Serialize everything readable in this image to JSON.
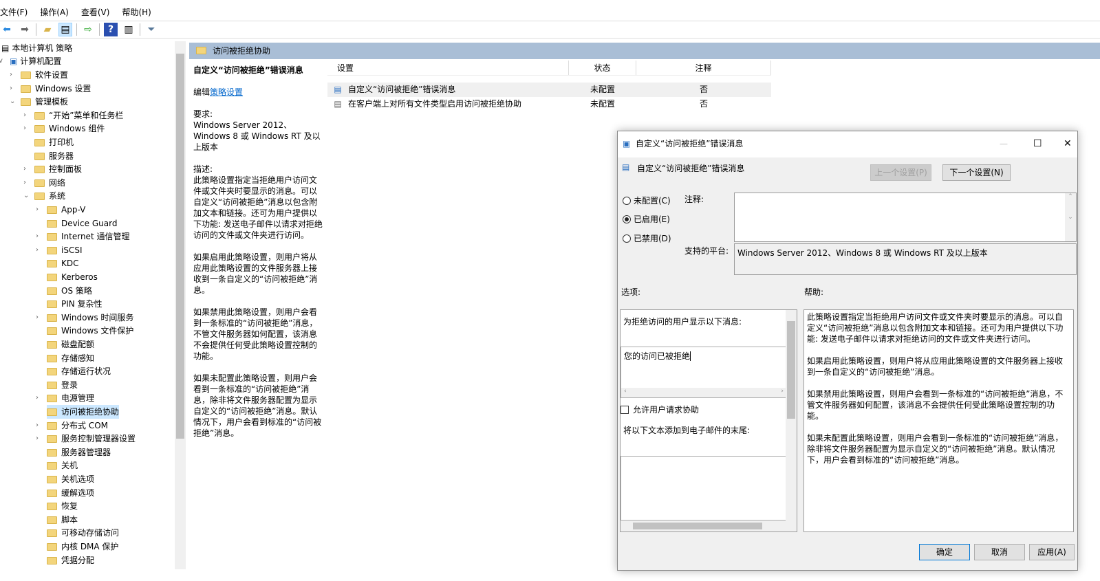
{
  "menu": [
    "文件(F)",
    "操作(A)",
    "查看(V)",
    "帮助(H)"
  ],
  "toolbar": [
    "back-icon",
    "forward-icon",
    "up-folder-icon",
    "show-hide-tree-icon",
    "export-icon",
    "help-icon",
    "show-action-pane-icon",
    "filter-icon"
  ],
  "tree": {
    "root": "本地计算机 策略",
    "computer": "计算机配置",
    "items": [
      {
        "label": "软件设置",
        "lvl": 1,
        "chev": ">"
      },
      {
        "label": "Windows 设置",
        "lvl": 1,
        "chev": ">"
      },
      {
        "label": "管理模板",
        "lvl": 1,
        "chev": "v"
      },
      {
        "label": "“开始”菜单和任务栏",
        "lvl": 2,
        "chev": ">"
      },
      {
        "label": "Windows 组件",
        "lvl": 2,
        "chev": ">"
      },
      {
        "label": "打印机",
        "lvl": 2,
        "chev": ""
      },
      {
        "label": "服务器",
        "lvl": 2,
        "chev": ""
      },
      {
        "label": "控制面板",
        "lvl": 2,
        "chev": ">"
      },
      {
        "label": "网络",
        "lvl": 2,
        "chev": ">"
      },
      {
        "label": "系统",
        "lvl": 2,
        "chev": "v"
      },
      {
        "label": "App-V",
        "lvl": 3,
        "chev": ">"
      },
      {
        "label": "Device Guard",
        "lvl": 3,
        "chev": ""
      },
      {
        "label": "Internet 通信管理",
        "lvl": 3,
        "chev": ">"
      },
      {
        "label": "iSCSI",
        "lvl": 3,
        "chev": ">"
      },
      {
        "label": "KDC",
        "lvl": 3,
        "chev": ""
      },
      {
        "label": "Kerberos",
        "lvl": 3,
        "chev": ""
      },
      {
        "label": "OS 策略",
        "lvl": 3,
        "chev": ""
      },
      {
        "label": "PIN 复杂性",
        "lvl": 3,
        "chev": ""
      },
      {
        "label": "Windows 时间服务",
        "lvl": 3,
        "chev": ">"
      },
      {
        "label": "Windows 文件保护",
        "lvl": 3,
        "chev": ""
      },
      {
        "label": "磁盘配额",
        "lvl": 3,
        "chev": ""
      },
      {
        "label": "存储感知",
        "lvl": 3,
        "chev": ""
      },
      {
        "label": "存储运行状况",
        "lvl": 3,
        "chev": ""
      },
      {
        "label": "登录",
        "lvl": 3,
        "chev": ""
      },
      {
        "label": "电源管理",
        "lvl": 3,
        "chev": ">"
      },
      {
        "label": "访问被拒绝协助",
        "lvl": 3,
        "chev": "",
        "sel": true
      },
      {
        "label": "分布式 COM",
        "lvl": 3,
        "chev": ">"
      },
      {
        "label": "服务控制管理器设置",
        "lvl": 3,
        "chev": ">"
      },
      {
        "label": "服务器管理器",
        "lvl": 3,
        "chev": ""
      },
      {
        "label": "关机",
        "lvl": 3,
        "chev": ""
      },
      {
        "label": "关机选项",
        "lvl": 3,
        "chev": ""
      },
      {
        "label": "缓解选项",
        "lvl": 3,
        "chev": ""
      },
      {
        "label": "恢复",
        "lvl": 3,
        "chev": ""
      },
      {
        "label": "脚本",
        "lvl": 3,
        "chev": ""
      },
      {
        "label": "可移动存储访问",
        "lvl": 3,
        "chev": ""
      },
      {
        "label": "内核 DMA 保护",
        "lvl": 3,
        "chev": ""
      },
      {
        "label": "凭据分配",
        "lvl": 3,
        "chev": ""
      }
    ]
  },
  "header": "访问被拒绝协助",
  "desc": {
    "title": "自定义“访问被拒绝”错误消息",
    "edit": "编辑",
    "edit_link": "策略设置",
    "req_label": "要求:",
    "req": "Windows Server 2012、Windows 8 或 Windows RT 及以上版本",
    "desc_label": "描述:",
    "p1": "此策略设置指定当拒绝用户访问文件或文件夹时要显示的消息。可以自定义“访问被拒绝”消息以包含附加文本和链接。还可为用户提供以下功能: 发送电子邮件以请求对拒绝访问的文件或文件夹进行访问。",
    "p2": "如果启用此策略设置，则用户将从应用此策略设置的文件服务器上接收到一条自定义的“访问被拒绝”消息。",
    "p3": "如果禁用此策略设置，则用户会看到一条标准的“访问被拒绝”消息，不管文件服务器如何配置，该消息不会提供任何受此策略设置控制的功能。",
    "p4": "如果未配置此策略设置，则用户会看到一条标准的“访问被拒绝”消息，除非将文件服务器配置为显示自定义的“访问被拒绝”消息。默认情况下，用户会看到标准的“访问被拒绝”消息。"
  },
  "list": {
    "cols": [
      "设置",
      "状态",
      "注释"
    ],
    "rows": [
      [
        "自定义“访问被拒绝”错误消息",
        "未配置",
        "否"
      ],
      [
        "在客户端上对所有文件类型启用访问被拒绝协助",
        "未配置",
        "否"
      ]
    ]
  },
  "dialog": {
    "title": "自定义“访问被拒绝”错误消息",
    "policy": "自定义“访问被拒绝”错误消息",
    "prev": "上一个设置(P)",
    "next": "下一个设置(N)",
    "radios": [
      "未配置(C)",
      "已启用(E)",
      "已禁用(D)"
    ],
    "selected": 1,
    "comment_label": "注释:",
    "platform_label": "支持的平台:",
    "platform": "Windows Server 2012、Windows 8 或 Windows RT 及以上版本",
    "options_label": "选项:",
    "help_label": "帮助:",
    "opt_msg_label": "为拒绝访问的用户显示以下消息:",
    "opt_msg_value": "您的访问已被拒绝",
    "opt_checkbox": "允许用户请求协助",
    "opt_checked": false,
    "opt_email_label": "将以下文本添加到电子邮件的末尾:",
    "help": "此策略设置指定当拒绝用户访问文件或文件夹时要显示的消息。可以自定义“访问被拒绝”消息以包含附加文本和链接。还可为用户提供以下功能: 发送电子邮件以请求对拒绝访问的文件或文件夹进行访问。\n\n如果启用此策略设置，则用户将从应用此策略设置的文件服务器上接收到一条自定义的“访问被拒绝”消息。\n\n如果禁用此策略设置，则用户会看到一条标准的“访问被拒绝”消息，不管文件服务器如何配置，该消息不会提供任何受此策略设置控制的功能。\n\n如果未配置此策略设置，则用户会看到一条标准的“访问被拒绝”消息，除非将文件服务器配置为显示自定义的“访问被拒绝”消息。默认情况下，用户会看到标准的“访问被拒绝”消息。",
    "ok": "确定",
    "cancel": "取消",
    "apply": "应用(A)"
  }
}
